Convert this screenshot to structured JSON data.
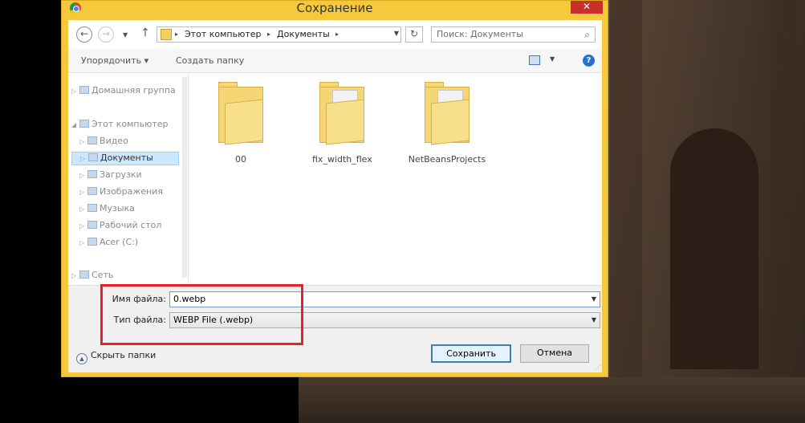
{
  "window": {
    "title": "Сохранение",
    "close_glyph": "✕"
  },
  "nav": {
    "back_glyph": "←",
    "forward_glyph": "→",
    "dropdown_glyph": "▼",
    "up_glyph": "↑",
    "refresh_glyph": "↻"
  },
  "address": {
    "parts": [
      "Этот компьютер",
      "Документы"
    ],
    "separator_glyph": "▸",
    "dropdown_glyph": "▼"
  },
  "search": {
    "placeholder": "Поиск: Документы",
    "icon_glyph": "⌕"
  },
  "toolbar": {
    "organize_label": "Упорядочить ▾",
    "new_folder_label": "Создать папку",
    "help_glyph": "?",
    "view_dropdown_glyph": "▼"
  },
  "navpane": {
    "items": [
      {
        "label": "Домашняя группа",
        "chevron": "▷"
      },
      {
        "label": "Этот компьютер",
        "chevron": "◢"
      },
      {
        "label": "Видео",
        "chevron": "▷"
      },
      {
        "label": "Документы",
        "chevron": "▷"
      },
      {
        "label": "Загрузки",
        "chevron": "▷"
      },
      {
        "label": "Изображения",
        "chevron": "▷"
      },
      {
        "label": "Музыка",
        "chevron": "▷"
      },
      {
        "label": "Рабочий стол",
        "chevron": "▷"
      },
      {
        "label": "Acer (C:)",
        "chevron": "▷"
      },
      {
        "label": "Сеть",
        "chevron": "▷"
      }
    ]
  },
  "folders": [
    {
      "label": "00"
    },
    {
      "label": "fix_width_flex"
    },
    {
      "label": "NetBeansProjects"
    }
  ],
  "form": {
    "filename_label": "Имя файла:",
    "filename_value": "0.webp",
    "filetype_label": "Тип файла:",
    "filetype_value": "WEBP File (.webp)",
    "dropdown_glyph": "▼",
    "hide_folders_label": "Скрыть папки",
    "hide_folders_glyph": "▲",
    "save_label": "Сохранить",
    "cancel_label": "Отмена",
    "grip_glyph": "⋰"
  },
  "colors": {
    "dialog_frame": "#f6c83c",
    "close_button": "#c7302b",
    "highlight_box": "#e8202a",
    "selection": "#cce8ff"
  }
}
